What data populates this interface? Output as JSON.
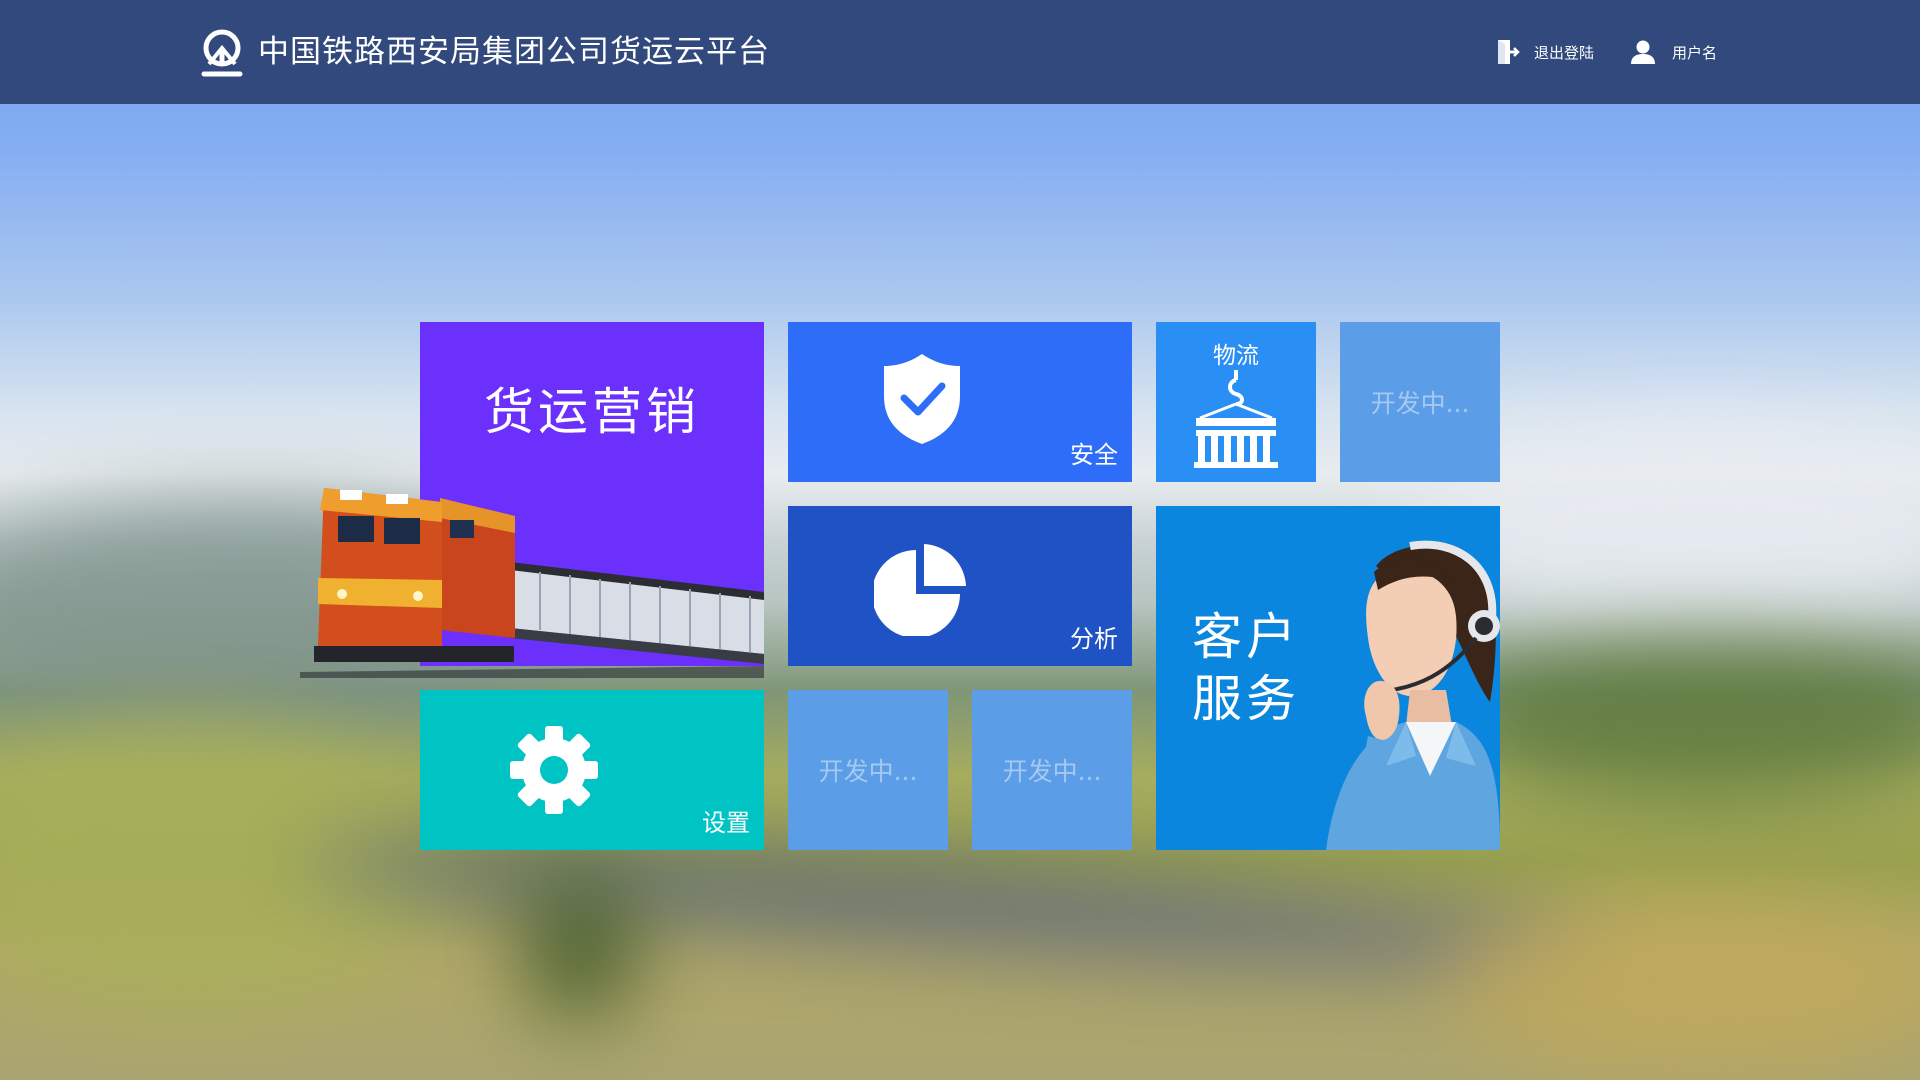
{
  "header": {
    "title": "中国铁路西安局集团公司货运云平台",
    "logout_label": "退出登陆",
    "username": "用户名",
    "bg_color": "#31497c"
  },
  "tiles": {
    "freight_marketing": {
      "label": "货运营销",
      "color": "#6b30fb"
    },
    "safety": {
      "label": "安全",
      "icon": "shield-check-icon",
      "color": "#2d6df7"
    },
    "logistics": {
      "label": "物流",
      "icon": "crane-container-icon",
      "color": "#2a8ff4"
    },
    "dev_1": {
      "label": "开发中...",
      "color": "#5b9de6"
    },
    "analysis": {
      "label": "分析",
      "icon": "pie-chart-icon",
      "color": "#1f52c4"
    },
    "customer_service": {
      "label_line1": "客户",
      "label_line2": "服务",
      "color": "#0b86de"
    },
    "settings": {
      "label": "设置",
      "icon": "gear-icon",
      "color": "#00c3c4"
    },
    "dev_2": {
      "label": "开发中...",
      "color": "#5b9de6"
    },
    "dev_3": {
      "label": "开发中...",
      "color": "#5b9de6"
    }
  }
}
